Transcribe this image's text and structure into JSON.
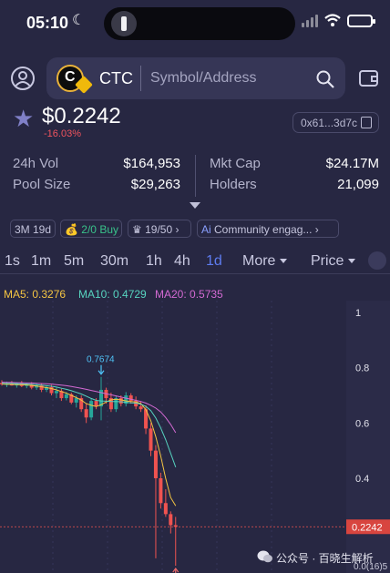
{
  "status_bar": {
    "time": "05:10",
    "moon_glyph": "☾"
  },
  "header": {
    "coin_symbol": "CTC",
    "search_placeholder": "Symbol/Address"
  },
  "token": {
    "price": "$0.2242",
    "change": "-16.03%",
    "address_short": "0x61...3d7c"
  },
  "stats": {
    "vol_label": "24h Vol",
    "vol_value": "$164,953",
    "pool_label": "Pool Size",
    "pool_value": "$29,263",
    "mcap_label": "Mkt Cap",
    "mcap_value": "$24.17M",
    "holders_label": "Holders",
    "holders_value": "21,099"
  },
  "chips": {
    "age": "3M 19d",
    "buy_sep": "2/0",
    "buy_word": "Buy",
    "holders_ratio": "19/50",
    "community": "Community engag...",
    "crown_glyph": "♛",
    "money_glyph": "💰",
    "ai_prefix": "Ai"
  },
  "timeframes": [
    "1s",
    "1m",
    "5m",
    "30m",
    "1h",
    "4h",
    "1d"
  ],
  "timeframe_active": "1d",
  "more_label": "More",
  "price_label": "Price",
  "indicators": {
    "ma5": "MA5: 0.3276",
    "ma10": "MA10: 0.4729",
    "ma20": "MA20: 0.5735",
    "ma5_color": "#f5c542",
    "ma10_color": "#57d4c0",
    "ma20_color": "#d36ad3"
  },
  "colors": {
    "up": "#26a69a",
    "down": "#ef5350",
    "accent": "#5e7cf0",
    "background": "#272742"
  },
  "chart_data": {
    "type": "candlestick",
    "y_ticks": [
      "1",
      "0.8",
      "0.6",
      "0.4"
    ],
    "y_tick_values": [
      1,
      0.8,
      0.6,
      0.4
    ],
    "ylim": [
      0.07,
      1.03
    ],
    "current_price_label": "0.2242",
    "current_price": 0.2242,
    "high_marker": "0.7674",
    "low_marker": "0.08317",
    "bottom_right_label": "0.0(16)5",
    "candles": [
      {
        "o": 0.745,
        "h": 0.755,
        "l": 0.735,
        "c": 0.74
      },
      {
        "o": 0.74,
        "h": 0.75,
        "l": 0.73,
        "c": 0.742
      },
      {
        "o": 0.742,
        "h": 0.752,
        "l": 0.735,
        "c": 0.736
      },
      {
        "o": 0.736,
        "h": 0.748,
        "l": 0.728,
        "c": 0.744
      },
      {
        "o": 0.744,
        "h": 0.752,
        "l": 0.73,
        "c": 0.734
      },
      {
        "o": 0.734,
        "h": 0.746,
        "l": 0.726,
        "c": 0.74
      },
      {
        "o": 0.74,
        "h": 0.748,
        "l": 0.722,
        "c": 0.728
      },
      {
        "o": 0.728,
        "h": 0.742,
        "l": 0.72,
        "c": 0.736
      },
      {
        "o": 0.736,
        "h": 0.744,
        "l": 0.712,
        "c": 0.72
      },
      {
        "o": 0.72,
        "h": 0.736,
        "l": 0.712,
        "c": 0.73
      },
      {
        "o": 0.73,
        "h": 0.738,
        "l": 0.7,
        "c": 0.708
      },
      {
        "o": 0.708,
        "h": 0.728,
        "l": 0.69,
        "c": 0.716
      },
      {
        "o": 0.716,
        "h": 0.724,
        "l": 0.68,
        "c": 0.69
      },
      {
        "o": 0.69,
        "h": 0.712,
        "l": 0.682,
        "c": 0.704
      },
      {
        "o": 0.704,
        "h": 0.71,
        "l": 0.668,
        "c": 0.674
      },
      {
        "o": 0.674,
        "h": 0.7,
        "l": 0.656,
        "c": 0.69
      },
      {
        "o": 0.69,
        "h": 0.7,
        "l": 0.64,
        "c": 0.65
      },
      {
        "o": 0.65,
        "h": 0.672,
        "l": 0.6,
        "c": 0.62
      },
      {
        "o": 0.62,
        "h": 0.688,
        "l": 0.61,
        "c": 0.68
      },
      {
        "o": 0.68,
        "h": 0.69,
        "l": 0.65,
        "c": 0.66
      },
      {
        "o": 0.66,
        "h": 0.767,
        "l": 0.61,
        "c": 0.72
      },
      {
        "o": 0.72,
        "h": 0.728,
        "l": 0.67,
        "c": 0.69
      },
      {
        "o": 0.69,
        "h": 0.71,
        "l": 0.64,
        "c": 0.65
      },
      {
        "o": 0.65,
        "h": 0.7,
        "l": 0.64,
        "c": 0.69
      },
      {
        "o": 0.69,
        "h": 0.7,
        "l": 0.66,
        "c": 0.67
      },
      {
        "o": 0.67,
        "h": 0.712,
        "l": 0.66,
        "c": 0.7
      },
      {
        "o": 0.7,
        "h": 0.708,
        "l": 0.67,
        "c": 0.68
      },
      {
        "o": 0.68,
        "h": 0.696,
        "l": 0.65,
        "c": 0.66
      },
      {
        "o": 0.66,
        "h": 0.678,
        "l": 0.64,
        "c": 0.65
      },
      {
        "o": 0.65,
        "h": 0.664,
        "l": 0.56,
        "c": 0.58
      },
      {
        "o": 0.58,
        "h": 0.6,
        "l": 0.48,
        "c": 0.5
      },
      {
        "o": 0.5,
        "h": 0.52,
        "l": 0.11,
        "c": 0.4
      },
      {
        "o": 0.4,
        "h": 0.42,
        "l": 0.29,
        "c": 0.31
      },
      {
        "o": 0.31,
        "h": 0.36,
        "l": 0.26,
        "c": 0.27
      },
      {
        "o": 0.27,
        "h": 0.28,
        "l": 0.2,
        "c": 0.23
      },
      {
        "o": 0.23,
        "h": 0.26,
        "l": 0.083,
        "c": 0.2242
      }
    ],
    "ma5": [
      0.741,
      0.74,
      0.74,
      0.739,
      0.739,
      0.738,
      0.736,
      0.734,
      0.731,
      0.728,
      0.725,
      0.72,
      0.714,
      0.708,
      0.7,
      0.692,
      0.683,
      0.67,
      0.664,
      0.66,
      0.666,
      0.676,
      0.684,
      0.686,
      0.684,
      0.68,
      0.678,
      0.676,
      0.67,
      0.648,
      0.608,
      0.55,
      0.48,
      0.4,
      0.33,
      0.3
    ],
    "ma10": [
      0.744,
      0.743,
      0.743,
      0.742,
      0.742,
      0.741,
      0.74,
      0.739,
      0.737,
      0.735,
      0.733,
      0.73,
      0.726,
      0.722,
      0.717,
      0.711,
      0.705,
      0.697,
      0.689,
      0.682,
      0.68,
      0.679,
      0.678,
      0.678,
      0.677,
      0.675,
      0.673,
      0.672,
      0.668,
      0.66,
      0.645,
      0.618,
      0.582,
      0.54,
      0.49,
      0.44
    ],
    "ma20": [
      0.748,
      0.747,
      0.747,
      0.746,
      0.746,
      0.745,
      0.745,
      0.744,
      0.743,
      0.742,
      0.741,
      0.739,
      0.737,
      0.735,
      0.732,
      0.729,
      0.726,
      0.722,
      0.718,
      0.714,
      0.71,
      0.706,
      0.702,
      0.698,
      0.694,
      0.69,
      0.686,
      0.682,
      0.678,
      0.672,
      0.664,
      0.654,
      0.64,
      0.62,
      0.595,
      0.565
    ]
  },
  "watermark": {
    "text": "公众号 · 百晓生解析"
  }
}
